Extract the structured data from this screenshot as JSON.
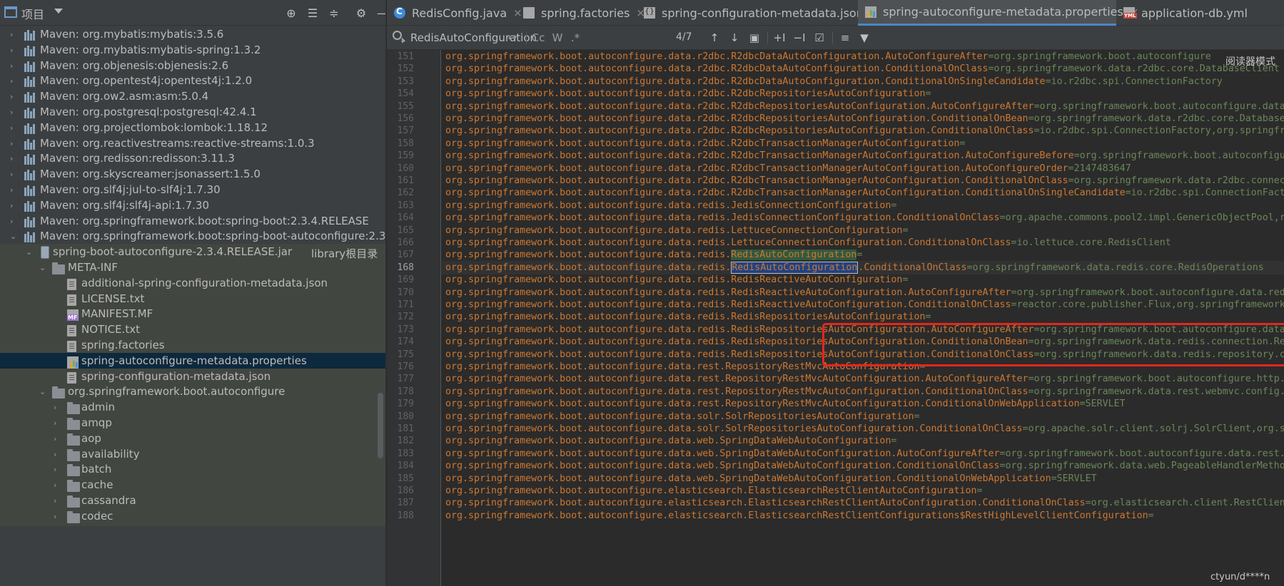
{
  "project": {
    "title": "项目",
    "toolbar": [
      "locate-icon",
      "expand-all-icon",
      "collapse-all-icon",
      "settings-icon",
      "hide-icon"
    ],
    "tree": [
      {
        "label": "Maven: org.mybatis:mybatis:3.5.6",
        "depth": 0,
        "type": "lib",
        "expanded": false
      },
      {
        "label": "Maven: org.mybatis:mybatis-spring:1.3.2",
        "depth": 0,
        "type": "lib",
        "expanded": false
      },
      {
        "label": "Maven: org.objenesis:objenesis:2.6",
        "depth": 0,
        "type": "lib",
        "expanded": false
      },
      {
        "label": "Maven: org.opentest4j:opentest4j:1.2.0",
        "depth": 0,
        "type": "lib",
        "expanded": false
      },
      {
        "label": "Maven: org.ow2.asm:asm:5.0.4",
        "depth": 0,
        "type": "lib",
        "expanded": false
      },
      {
        "label": "Maven: org.postgresql:postgresql:42.4.1",
        "depth": 0,
        "type": "lib",
        "expanded": false
      },
      {
        "label": "Maven: org.projectlombok:lombok:1.18.12",
        "depth": 0,
        "type": "lib",
        "expanded": false
      },
      {
        "label": "Maven: org.reactivestreams:reactive-streams:1.0.3",
        "depth": 0,
        "type": "lib",
        "expanded": false
      },
      {
        "label": "Maven: org.redisson:redisson:3.11.3",
        "depth": 0,
        "type": "lib",
        "expanded": false
      },
      {
        "label": "Maven: org.skyscreamer:jsonassert:1.5.0",
        "depth": 0,
        "type": "lib",
        "expanded": false
      },
      {
        "label": "Maven: org.slf4j:jul-to-slf4j:1.7.30",
        "depth": 0,
        "type": "lib",
        "expanded": false
      },
      {
        "label": "Maven: org.slf4j:slf4j-api:1.7.30",
        "depth": 0,
        "type": "lib",
        "expanded": false
      },
      {
        "label": "Maven: org.springframework.boot:spring-boot:2.3.4.RELEASE",
        "depth": 0,
        "type": "lib",
        "expanded": false
      },
      {
        "label": "Maven: org.springframework.boot:spring-boot-autoconfigure:2.3",
        "depth": 0,
        "type": "lib",
        "expanded": true
      },
      {
        "label": "spring-boot-autoconfigure-2.3.4.RELEASE.jar",
        "suffix": "library根目录",
        "depth": 1,
        "type": "jar",
        "expanded": true
      },
      {
        "label": "META-INF",
        "depth": 2,
        "type": "folder",
        "expanded": true
      },
      {
        "label": "additional-spring-configuration-metadata.json",
        "depth": 3,
        "type": "file"
      },
      {
        "label": "LICENSE.txt",
        "depth": 3,
        "type": "file"
      },
      {
        "label": "MANIFEST.MF",
        "depth": 3,
        "type": "mf"
      },
      {
        "label": "NOTICE.txt",
        "depth": 3,
        "type": "file"
      },
      {
        "label": "spring.factories",
        "depth": 3,
        "type": "file"
      },
      {
        "label": "spring-autoconfigure-metadata.properties",
        "depth": 3,
        "type": "prop",
        "selected": true
      },
      {
        "label": "spring-configuration-metadata.json",
        "depth": 3,
        "type": "file"
      },
      {
        "label": "org.springframework.boot.autoconfigure",
        "depth": 2,
        "type": "folder",
        "expanded": true
      },
      {
        "label": "admin",
        "depth": 3,
        "type": "folder",
        "expanded": false
      },
      {
        "label": "amqp",
        "depth": 3,
        "type": "folder",
        "expanded": false
      },
      {
        "label": "aop",
        "depth": 3,
        "type": "folder",
        "expanded": false
      },
      {
        "label": "availability",
        "depth": 3,
        "type": "folder",
        "expanded": false
      },
      {
        "label": "batch",
        "depth": 3,
        "type": "folder",
        "expanded": false
      },
      {
        "label": "cache",
        "depth": 3,
        "type": "folder",
        "expanded": false
      },
      {
        "label": "cassandra",
        "depth": 3,
        "type": "folder",
        "expanded": false
      },
      {
        "label": "codec",
        "depth": 3,
        "type": "folder",
        "expanded": false
      }
    ]
  },
  "tabs": [
    {
      "label": "RedisConfig.java",
      "icon": "java",
      "active": false
    },
    {
      "label": "spring.factories",
      "icon": "file",
      "active": false
    },
    {
      "label": "spring-configuration-metadata.json",
      "icon": "json",
      "active": false
    },
    {
      "label": "spring-autoconfigure-metadata.properties",
      "icon": "prop",
      "active": true
    },
    {
      "label": "application-db.yml",
      "icon": "yml",
      "active": false
    }
  ],
  "search": {
    "query": "RedisAutoConfiguration",
    "match_count": "4/7",
    "icons": [
      "regex-history-icon",
      "match-case-icon",
      "words-icon",
      "regex-icon",
      "prev-occurrence-icon",
      "next-occurrence-icon",
      "select-all-occurrences-icon",
      "add-occurrence-icon",
      "remove-occurrence-icon",
      "toggle-selection-icon",
      "multiline-icon",
      "filter-icon"
    ],
    "labels": {
      "match_case": "Cc",
      "words": "W",
      "regex": ".*"
    }
  },
  "editor": {
    "current_line": 168,
    "reader_mode": "阅读器模式",
    "watermark": "ctyun/d****n",
    "lines": [
      {
        "n": 151,
        "t": "org.springframework.boot.autoconfigure.data.r2dbc.R2dbcDataAutoConfiguration.AutoConfigureAfter=org.springframework.boot.autoconfigure"
      },
      {
        "n": 152,
        "t": "org.springframework.boot.autoconfigure.data.r2dbc.R2dbcDataAutoConfiguration.ConditionalOnClass=org.springframework.data.r2dbc.core.DatabaseClient"
      },
      {
        "n": 153,
        "t": "org.springframework.boot.autoconfigure.data.r2dbc.R2dbcDataAutoConfiguration.ConditionalOnSingleCandidate=io.r2dbc.spi.ConnectionFactory"
      },
      {
        "n": 154,
        "t": "org.springframework.boot.autoconfigure.data.r2dbc.R2dbcRepositoriesAutoConfiguration="
      },
      {
        "n": 155,
        "t": "org.springframework.boot.autoconfigure.data.r2dbc.R2dbcRepositoriesAutoConfiguration.AutoConfigureAfter=org.springframework.boot.autoconfigure.data"
      },
      {
        "n": 156,
        "t": "org.springframework.boot.autoconfigure.data.r2dbc.R2dbcRepositoriesAutoConfiguration.ConditionalOnBean=org.springframework.data.r2dbc.core.Database"
      },
      {
        "n": 157,
        "t": "org.springframework.boot.autoconfigure.data.r2dbc.R2dbcRepositoriesAutoConfiguration.ConditionalOnClass=io.r2dbc.spi.ConnectionFactory,org.springfr"
      },
      {
        "n": 158,
        "t": "org.springframework.boot.autoconfigure.data.r2dbc.R2dbcTransactionManagerAutoConfiguration="
      },
      {
        "n": 159,
        "t": "org.springframework.boot.autoconfigure.data.r2dbc.R2dbcTransactionManagerAutoConfiguration.AutoConfigureBefore=org.springframework.boot.autoconfigu"
      },
      {
        "n": 160,
        "t": "org.springframework.boot.autoconfigure.data.r2dbc.R2dbcTransactionManagerAutoConfiguration.AutoConfigureOrder=2147483647"
      },
      {
        "n": 161,
        "t": "org.springframework.boot.autoconfigure.data.r2dbc.R2dbcTransactionManagerAutoConfiguration.ConditionalOnClass=org.springframework.data.r2dbc.connec"
      },
      {
        "n": 162,
        "t": "org.springframework.boot.autoconfigure.data.r2dbc.R2dbcTransactionManagerAutoConfiguration.ConditionalOnSingleCandidate=io.r2dbc.spi.ConnectionFact"
      },
      {
        "n": 163,
        "t": "org.springframework.boot.autoconfigure.data.redis.JedisConnectionConfiguration="
      },
      {
        "n": 164,
        "t": "org.springframework.boot.autoconfigure.data.redis.JedisConnectionConfiguration.ConditionalOnClass=org.apache.commons.pool2.impl.GenericObjectPool,r"
      },
      {
        "n": 165,
        "t": "org.springframework.boot.autoconfigure.data.redis.LettuceConnectionConfiguration="
      },
      {
        "n": 166,
        "t": "org.springframework.boot.autoconfigure.data.redis.LettuceConnectionConfiguration.ConditionalOnClass=io.lettuce.core.RedisClient"
      },
      {
        "n": 167,
        "t": "org.springframework.boot.autoconfigure.data.redis.RedisAutoConfiguration="
      },
      {
        "n": 168,
        "t": "org.springframework.boot.autoconfigure.data.redis.RedisAutoConfiguration.ConditionalOnClass=org.springframework.data.redis.core.RedisOperations"
      },
      {
        "n": 169,
        "t": "org.springframework.boot.autoconfigure.data.redis.RedisReactiveAutoConfiguration="
      },
      {
        "n": 170,
        "t": "org.springframework.boot.autoconfigure.data.redis.RedisReactiveAutoConfiguration.AutoConfigureAfter=org.springframework.boot.autoconfigure.data.red"
      },
      {
        "n": 171,
        "t": "org.springframework.boot.autoconfigure.data.redis.RedisReactiveAutoConfiguration.ConditionalOnClass=reactor.core.publisher.Flux,org.springframework"
      },
      {
        "n": 172,
        "t": "org.springframework.boot.autoconfigure.data.redis.RedisRepositoriesAutoConfiguration="
      },
      {
        "n": 173,
        "t": "org.springframework.boot.autoconfigure.data.redis.RedisRepositoriesAutoConfiguration.AutoConfigureAfter=org.springframework.boot.autoconfigure.data"
      },
      {
        "n": 174,
        "t": "org.springframework.boot.autoconfigure.data.redis.RedisRepositoriesAutoConfiguration.ConditionalOnBean=org.springframework.data.redis.connection.Re"
      },
      {
        "n": 175,
        "t": "org.springframework.boot.autoconfigure.data.redis.RedisRepositoriesAutoConfiguration.ConditionalOnClass=org.springframework.data.redis.repository.c"
      },
      {
        "n": 176,
        "t": "org.springframework.boot.autoconfigure.data.rest.RepositoryRestMvcAutoConfiguration="
      },
      {
        "n": 177,
        "t": "org.springframework.boot.autoconfigure.data.rest.RepositoryRestMvcAutoConfiguration.AutoConfigureAfter=org.springframework.boot.autoconfigure.http."
      },
      {
        "n": 178,
        "t": "org.springframework.boot.autoconfigure.data.rest.RepositoryRestMvcAutoConfiguration.ConditionalOnClass=org.springframework.data.rest.webmvc.config."
      },
      {
        "n": 179,
        "t": "org.springframework.boot.autoconfigure.data.rest.RepositoryRestMvcAutoConfiguration.ConditionalOnWebApplication=SERVLET"
      },
      {
        "n": 180,
        "t": "org.springframework.boot.autoconfigure.data.solr.SolrRepositoriesAutoConfiguration="
      },
      {
        "n": 181,
        "t": "org.springframework.boot.autoconfigure.data.solr.SolrRepositoriesAutoConfiguration.ConditionalOnClass=org.apache.solr.client.solrj.SolrClient,org.s"
      },
      {
        "n": 182,
        "t": "org.springframework.boot.autoconfigure.data.web.SpringDataWebAutoConfiguration="
      },
      {
        "n": 183,
        "t": "org.springframework.boot.autoconfigure.data.web.SpringDataWebAutoConfiguration.AutoConfigureAfter=org.springframework.boot.autoconfigure.data.rest."
      },
      {
        "n": 184,
        "t": "org.springframework.boot.autoconfigure.data.web.SpringDataWebAutoConfiguration.ConditionalOnClass=org.springframework.data.web.PageableHandlerMetho"
      },
      {
        "n": 185,
        "t": "org.springframework.boot.autoconfigure.data.web.SpringDataWebAutoConfiguration.ConditionalOnWebApplication=SERVLET"
      },
      {
        "n": 186,
        "t": "org.springframework.boot.autoconfigure.elasticsearch.ElasticsearchRestClientAutoConfiguration="
      },
      {
        "n": 187,
        "t": "org.springframework.boot.autoconfigure.elasticsearch.ElasticsearchRestClientAutoConfiguration.ConditionalOnClass=org.elasticsearch.client.RestClien"
      },
      {
        "n": 188,
        "t": "org.springframework.boot.autoconfigure.elasticsearch.ElasticsearchRestClientConfigurations$RestHighLevelClientConfiguration="
      }
    ]
  },
  "colors": {
    "key": "#cc7832",
    "value": "#6a8759",
    "match_bg": "#32593d",
    "current_match_bg": "#214283",
    "annotation_box": "#e5261f",
    "tab_active_underline": "#4a88c7"
  }
}
